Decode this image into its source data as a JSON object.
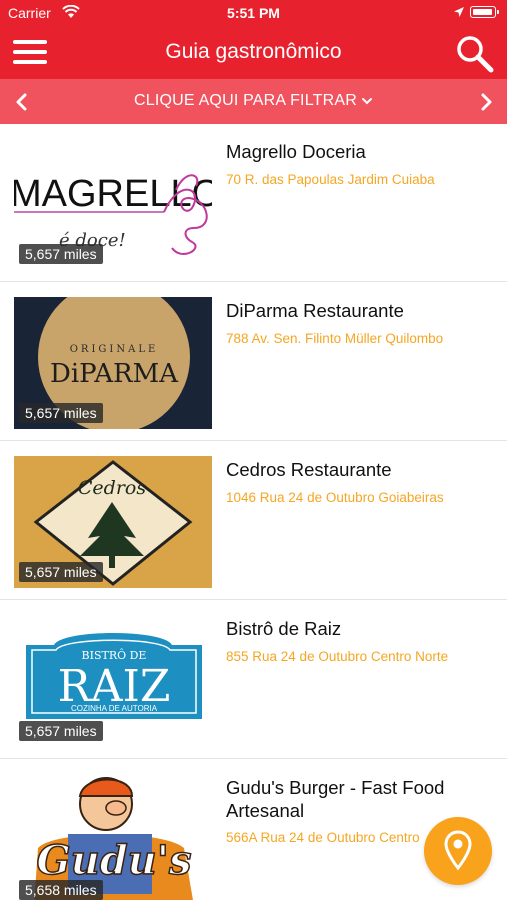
{
  "status": {
    "carrier": "Carrier",
    "time": "5:51 PM"
  },
  "nav": {
    "title": "Guia gastronômico"
  },
  "filter": {
    "label": "CLIQUE AQUI PARA FILTRAR"
  },
  "colors": {
    "primary": "#e8212e",
    "filter_bar": "#f0525e",
    "address": "#f5a623",
    "fab": "#f9a21b"
  },
  "restaurants": [
    {
      "name": "Magrello Doceria",
      "address": "70 R. das Papoulas Jardim Cuiaba",
      "distance": "5,657 miles",
      "logo": {
        "text1": "MAGRELLO",
        "text2": "é doce!"
      }
    },
    {
      "name": "DiParma Restaurante",
      "address": "788 Av. Sen. Filinto Müller Quilombo",
      "distance": "5,657 miles",
      "logo": {
        "text1": "ORIGINALE",
        "text2": "DiPARMA"
      }
    },
    {
      "name": "Cedros Restaurante",
      "address": "1046 Rua 24 de Outubro Goiabeiras",
      "distance": "5,657 miles",
      "logo": {
        "text1": "Cedros"
      }
    },
    {
      "name": "Bistrô de Raiz",
      "address": "855 Rua 24 de Outubro Centro Norte",
      "distance": "5,657 miles",
      "logo": {
        "text1": "BISTRÔ DE",
        "text2": "RAIZ",
        "text3": "COZINHA DE AUTORIA"
      }
    },
    {
      "name": "Gudu's Burger - Fast Food Artesanal",
      "address": "566A Rua 24 de Outubro Centro",
      "distance": "5,658 miles",
      "logo": {
        "text1": "Gudu's"
      }
    }
  ],
  "icons": {
    "menu": "hamburger-icon",
    "search": "search-icon",
    "prev": "chevron-left-icon",
    "next": "chevron-right-icon",
    "fab": "map-pin-icon"
  }
}
